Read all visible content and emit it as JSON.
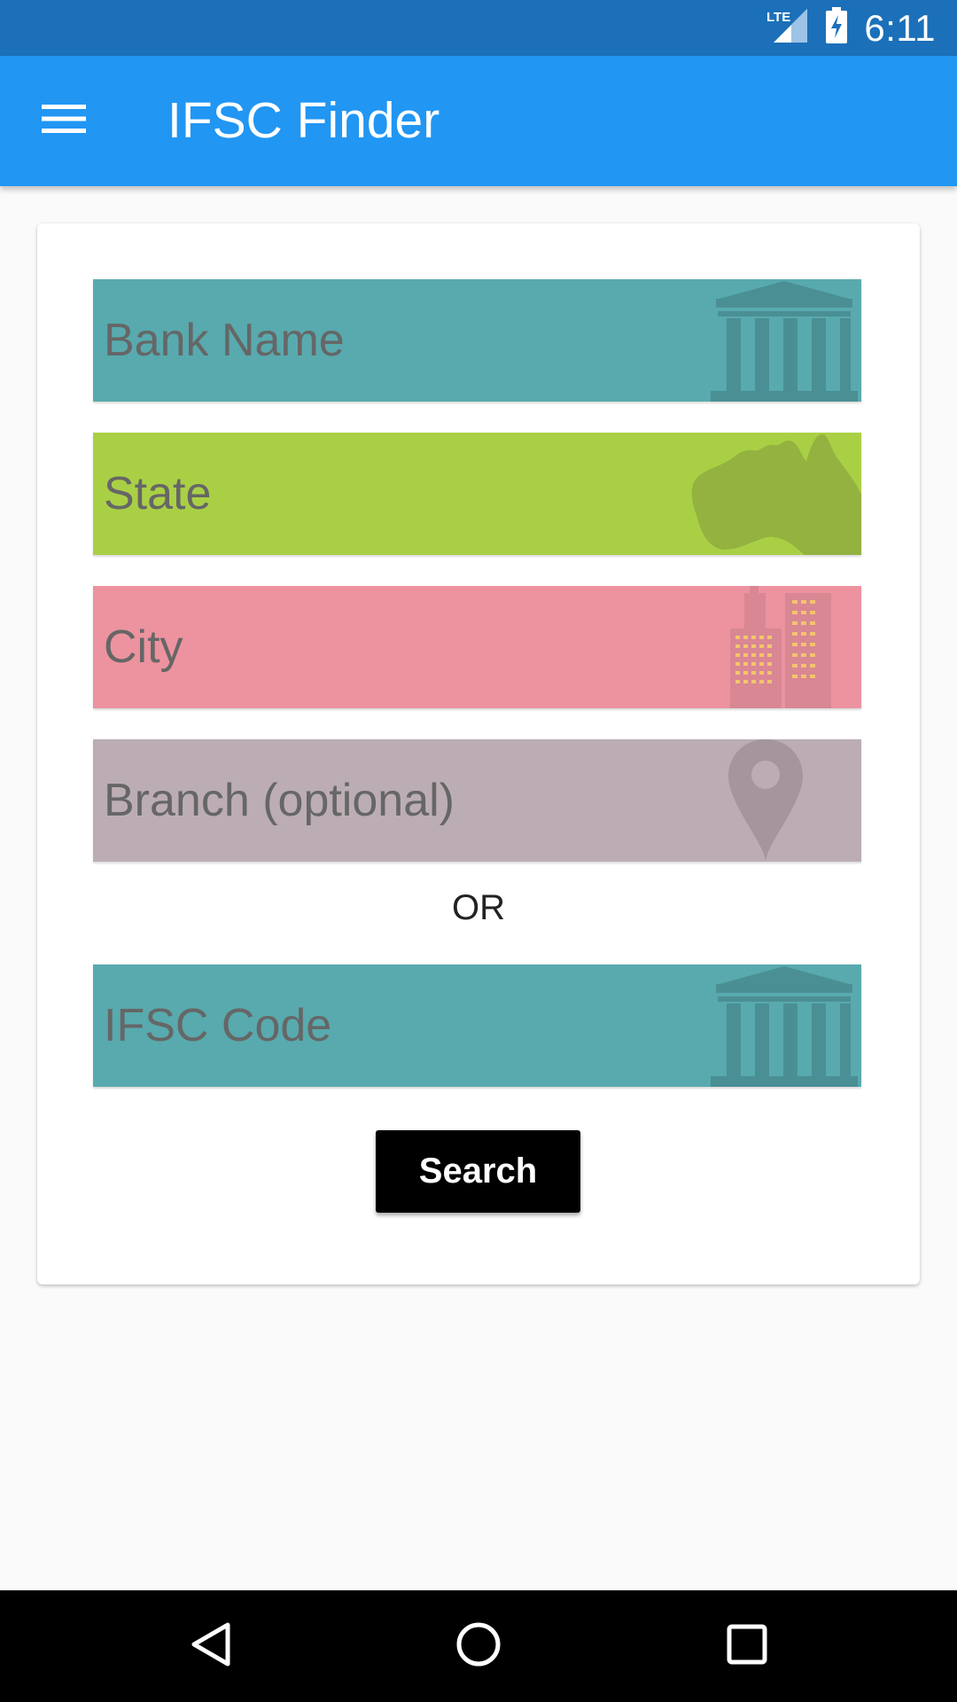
{
  "status_bar": {
    "time": "6:11",
    "network_label": "LTE",
    "icons": [
      "lte-signal-icon",
      "battery-charging-icon"
    ]
  },
  "app_bar": {
    "title": "IFSC Finder",
    "menu_icon": "hamburger-menu-icon"
  },
  "form": {
    "fields": {
      "bank_name": {
        "placeholder": "Bank Name",
        "value": "",
        "color": "#58aaae",
        "icon": "bank-building-icon"
      },
      "state": {
        "placeholder": "State",
        "value": "",
        "color": "#a9d045",
        "icon": "map-silhouette-icon"
      },
      "city": {
        "placeholder": "City",
        "value": "",
        "color": "#ec939f",
        "icon": "city-buildings-icon"
      },
      "branch": {
        "placeholder": "Branch (optional)",
        "value": "",
        "color": "#bcadb5",
        "icon": "location-pin-icon"
      },
      "ifsc_code": {
        "placeholder": "IFSC Code",
        "value": "",
        "color": "#58aaae",
        "icon": "bank-building-icon"
      }
    },
    "separator_label": "OR",
    "search_label": "Search"
  },
  "nav_bar": {
    "icons": [
      "back-triangle-icon",
      "home-circle-icon",
      "recents-square-icon"
    ]
  },
  "colors": {
    "status_bar": "#1b70b9",
    "app_bar": "#2196f3",
    "background": "#fafafa",
    "button": "#000000"
  }
}
